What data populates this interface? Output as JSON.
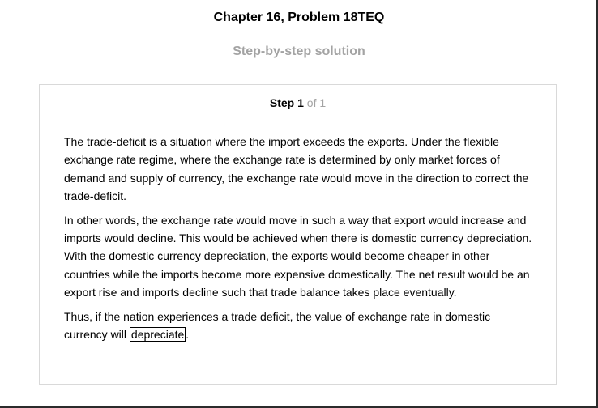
{
  "header": {
    "chapter_title": "Chapter 16, Problem 18TEQ",
    "subtitle": "Step-by-step solution"
  },
  "step": {
    "word": "Step",
    "number": "1",
    "of_text": "of 1"
  },
  "solution": {
    "paragraph_1": "The trade-deficit is a situation where the import exceeds the exports. Under the flexible exchange rate regime, where the exchange rate is determined by only market forces of demand and supply of currency, the exchange rate would move in the direction to correct the trade-deficit.",
    "paragraph_2": "In other words, the exchange rate would move in such a way that export would increase and imports would decline. This would be achieved when there is domestic currency depreciation. With the domestic currency depreciation, the exports would become cheaper in other countries while the imports become more expensive domestically. The net result would be an export rise and imports decline such that trade balance takes place eventually.",
    "paragraph_3_lead": "Thus, if the nation experiences a trade deficit, the value of exchange rate in domestic currency will",
    "answer": "depreciate",
    "paragraph_3_end": "."
  }
}
